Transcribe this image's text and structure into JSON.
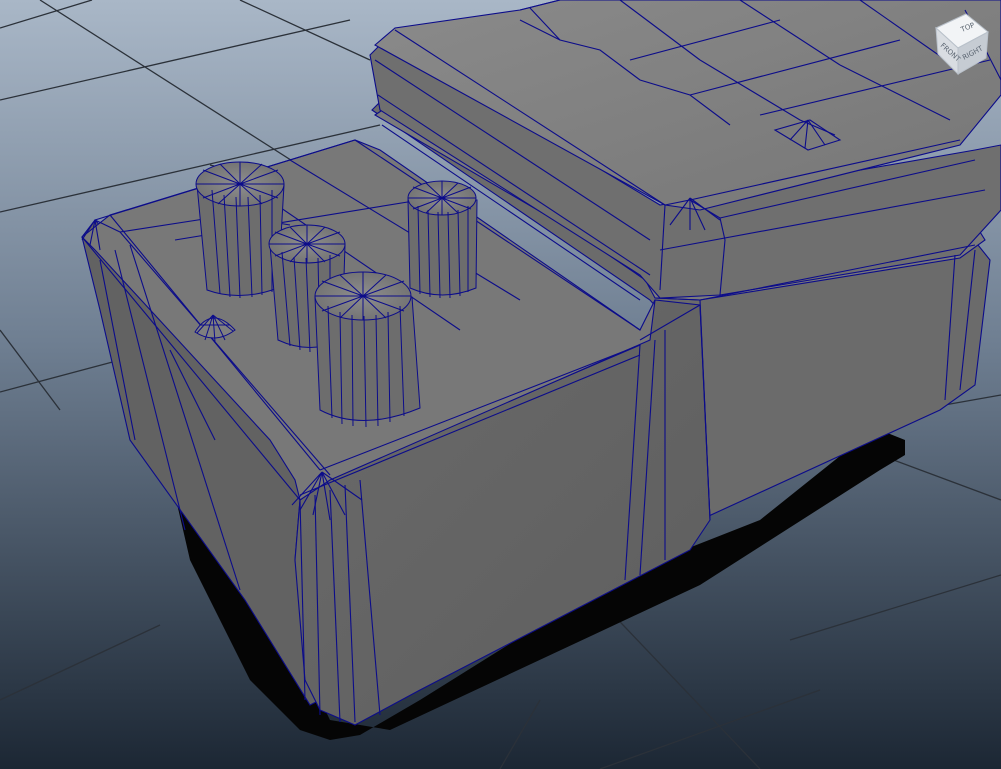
{
  "viewport": {
    "background_top": "#a9b6c6",
    "background_bottom": "#1e2a38",
    "grid_color": "#2a2f36",
    "mesh_face_color": "#757575",
    "wireframe_color": "#0c0c8a",
    "shadow_color": "#000000"
  },
  "viewcube": {
    "face_label": "FRONT",
    "top_label": "TOP",
    "side_label": "RIGHT"
  }
}
